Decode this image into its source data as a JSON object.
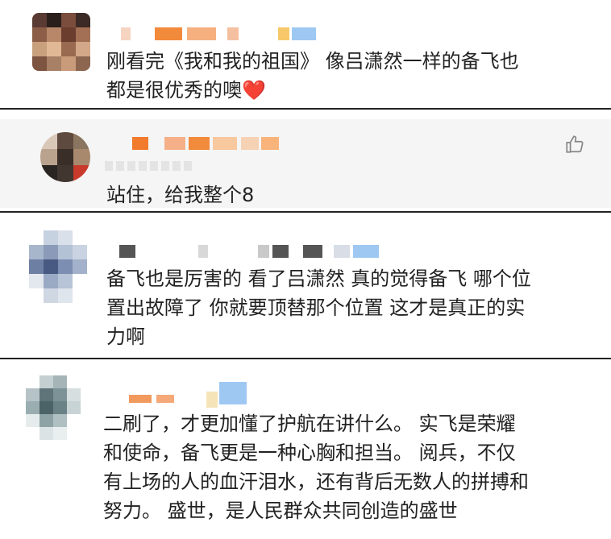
{
  "comments": [
    {
      "text_line1": "刚看完《我和我的祖国》 像吕潇然一样的备飞也",
      "text_line2": "都是很优秀的噢",
      "heart": "❤️"
    },
    {
      "text_line1": "站住，给我整个8",
      "like_icon": "thumbs-up-icon"
    },
    {
      "text_line1": "备飞也是厉害的 看了吕潇然 真的觉得备飞 哪个位",
      "text_line2": "置出故障了 你就要顶替那个位置 这才是真正的实",
      "text_line3": "力啊"
    },
    {
      "text_line1": "二刷了，才更加懂了护航在讲什么。 实飞是荣耀",
      "text_line2": "和使命，备飞更是一种心胸和担当。 阅兵，不仅",
      "text_line3": "有上场的人的血汗泪水，还有背后无数人的拼搏和",
      "text_line4": "努力。 盛世，是人民群众共同创造的盛世"
    }
  ],
  "colors": {
    "text": "#222222",
    "heart": "#e8222e",
    "separator": "#222222",
    "card2_bg": "#f5f5f5"
  }
}
